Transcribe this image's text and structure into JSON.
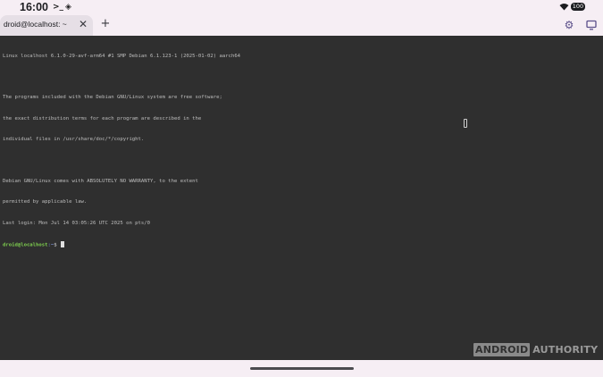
{
  "status_bar": {
    "time": "16:00",
    "icons": [
      "terminal-icon",
      "location-diamond-icon",
      "wifi-icon",
      "battery-icon"
    ],
    "terminal_glyph": ">_",
    "battery_level": "100"
  },
  "tabs": [
    {
      "label": "droid@localhost: ~",
      "active": true
    }
  ],
  "toolbar": {
    "settings_icon": "gear-icon",
    "display_icon": "display-icon"
  },
  "terminal": {
    "lines": [
      "Linux localhost 6.1.0-29-avf-arm64 #1 SMP Debian 6.1.123-1 (2025-01-02) aarch64",
      "",
      "The programs included with the Debian GNU/Linux system are free software;",
      "the exact distribution terms for each program are described in the",
      "individual files in /usr/share/doc/*/copyright.",
      "",
      "Debian GNU/Linux comes with ABSOLUTELY NO WARRANTY, to the extent",
      "permitted by applicable law.",
      "Last login: Mon Jul 14 03:05:26 UTC 2025 on pts/0"
    ],
    "prompt": {
      "user_host": "droid@localhost",
      "path": ":~",
      "sign": "$"
    }
  },
  "watermark": {
    "part1": "ANDROID",
    "part2": "AUTHORITY"
  },
  "colors": {
    "background": "#f6eef4",
    "terminal_bg": "#2f2f2f",
    "terminal_fg": "#bdbdbd",
    "prompt_user": "#7fd14f",
    "accent": "#5b4f8a"
  }
}
